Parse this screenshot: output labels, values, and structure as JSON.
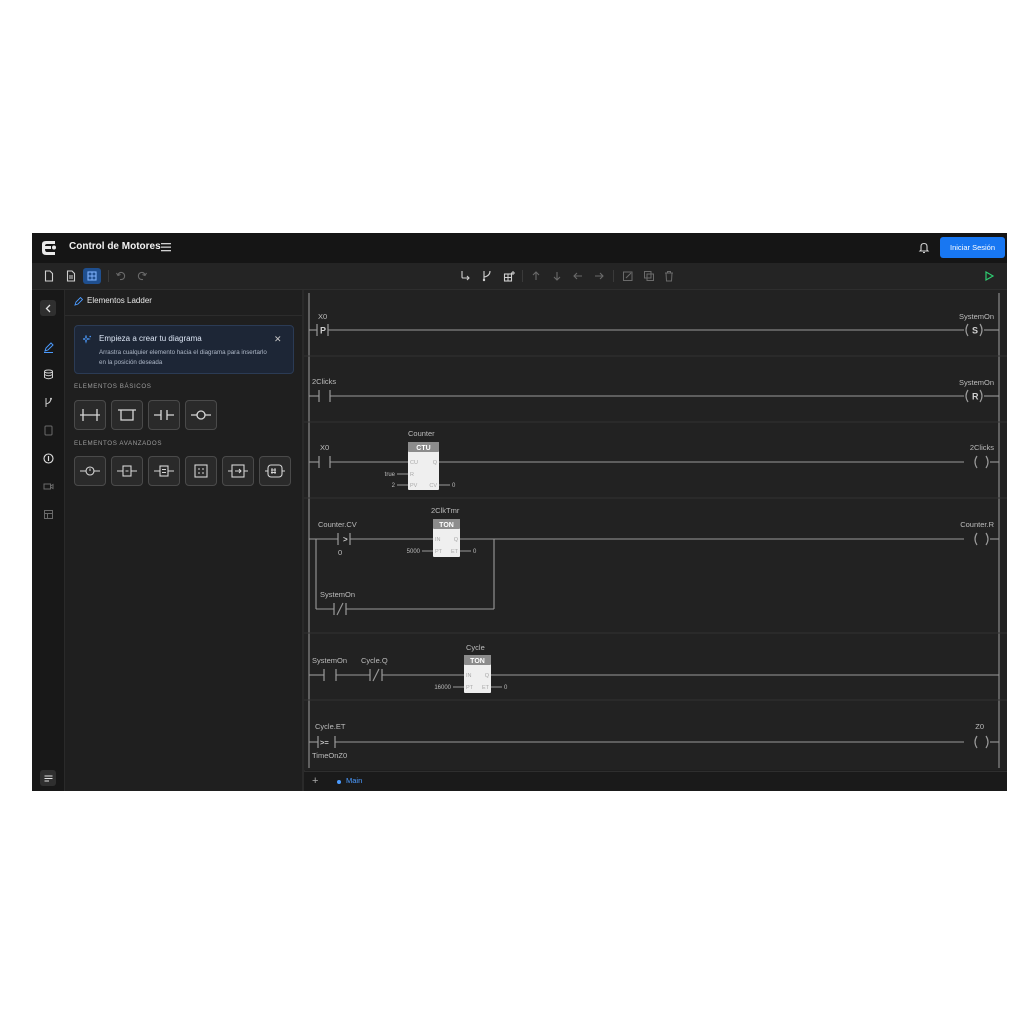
{
  "app": {
    "title": "Control de Motores",
    "login_button": "Iniciar Sesión",
    "icons": [
      "logo-icon",
      "menu-icon",
      "bell-icon"
    ]
  },
  "toolbar": {
    "left": [
      "new-file-icon",
      "document-icon",
      "component-icon",
      "undo-icon",
      "redo-icon"
    ],
    "center": [
      "branch-down-icon",
      "fork-icon",
      "grid-add-icon",
      "arrow-up-icon",
      "arrow-down-icon",
      "arrow-left-icon",
      "arrow-right-icon",
      "edit-icon",
      "copy-icon",
      "trash-icon"
    ],
    "right": [
      "run-icon"
    ],
    "colors": {
      "accent": "#1877f2",
      "run": "#2ecc71"
    }
  },
  "rail": [
    "collapse-icon",
    "ladder-pen-icon",
    "database-icon",
    "branch-icon",
    "device-icon",
    "info-icon",
    "camera-icon",
    "layout-icon",
    "settings-icon"
  ],
  "panel": {
    "title": "Elementos Ladder",
    "info": {
      "title": "Empieza a crear tu diagrama",
      "text": "Arrastra cualquier elemento hacia el diagrama para insertarlo en la posición deseada"
    },
    "basic_label": "ELEMENTOS BÁSICOS",
    "basic": [
      "contact-no-icon",
      "contact-nc-icon",
      "contact-parallel-icon",
      "coil-icon"
    ],
    "advanced_label": "ELEMENTOS AVANZADOS",
    "advanced": [
      "timer-icon",
      "counter-icon",
      "compare-icon",
      "math-icon",
      "move-icon",
      "function-block-icon"
    ]
  },
  "diagram": {
    "rungs": [
      {
        "contacts": [
          "X0"
        ],
        "contact_types": [
          "P"
        ],
        "coil": "SystemOn",
        "coil_type": "S"
      },
      {
        "contacts": [
          "2Clicks"
        ],
        "coil": "SystemOn",
        "coil_type": "R"
      },
      {
        "contacts": [
          "X0"
        ],
        "block": {
          "name": "Counter",
          "type": "CTU",
          "inputs": [
            "CU",
            "R",
            "PV"
          ],
          "outputs": [
            "Q",
            "CV"
          ],
          "r_value": "true",
          "pv_value": "2",
          "cv_value": "0"
        },
        "coil": "2Clicks"
      },
      {
        "contacts": [
          "Counter.CV"
        ],
        "compare": ">",
        "compare_value": "0",
        "block": {
          "name": "2ClkTmr",
          "type": "TON",
          "inputs": [
            "IN",
            "PT"
          ],
          "outputs": [
            "Q",
            "ET"
          ],
          "pt_value": "5000",
          "et_value": "0"
        },
        "coil": "Counter.R",
        "branch_contact": "SystemOn",
        "branch_type": "/"
      },
      {
        "contacts": [
          "SystemOn",
          "Cycle.Q"
        ],
        "contact_types": [
          "",
          "/"
        ],
        "block": {
          "name": "Cycle",
          "type": "TON",
          "inputs": [
            "IN",
            "PT"
          ],
          "outputs": [
            "Q",
            "ET"
          ],
          "pt_value": "16000",
          "et_value": "0"
        }
      },
      {
        "contacts": [
          "Cycle.ET"
        ],
        "compare": ">=",
        "compare_value": "TimeOnZ0",
        "coil": "Z0"
      }
    ]
  },
  "tabs": {
    "add": "+",
    "main": "Main"
  }
}
